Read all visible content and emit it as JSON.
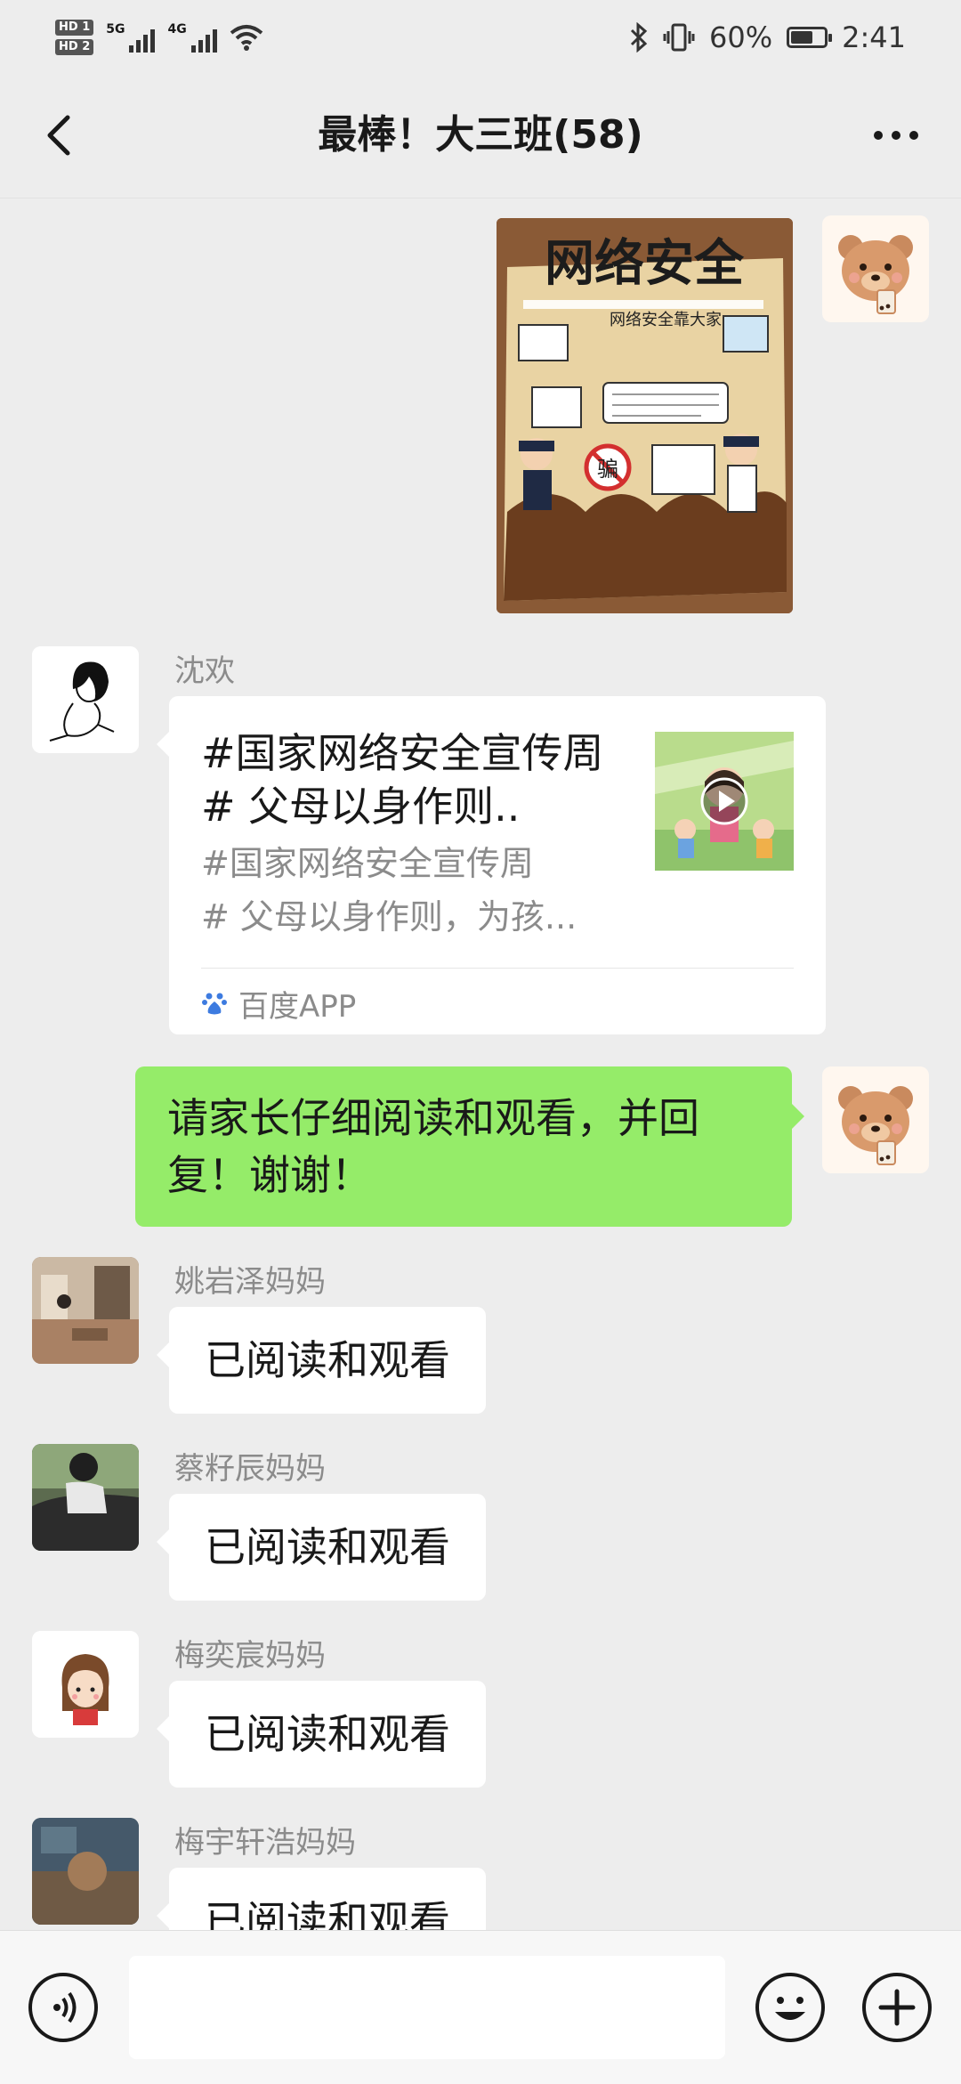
{
  "status_bar": {
    "hd1": "HD 1",
    "hd2": "HD 2",
    "net1": "5G",
    "net2": "4G",
    "battery_percent": "60%",
    "battery_level": 0.6,
    "time": "2:41"
  },
  "header": {
    "title": "最棒！大三班(58)"
  },
  "messages": {
    "link_card": {
      "sender": "沈欢",
      "title": "#国家网络安全宣传周# 父母以身作则..",
      "desc_line1": "#国家网络安全宣传周",
      "desc_line2": "# 父母以身作则，为孩...",
      "source": "百度APP"
    },
    "my_text": "请家长仔细阅读和观看，并回复！谢谢！",
    "replies": [
      {
        "sender": "姚岩泽妈妈",
        "text": "已阅读和观看"
      },
      {
        "sender": "蔡籽辰妈妈",
        "text": "已阅读和观看"
      },
      {
        "sender": "梅奕宸妈妈",
        "text": "已阅读和观看"
      },
      {
        "sender": "梅宇轩浩妈妈",
        "text": "已阅读和观看"
      }
    ]
  },
  "poster": {
    "title": "网络安全",
    "subtitle": "网络安全靠大家",
    "sign": "骗"
  },
  "colors": {
    "background": "#ededed",
    "my_bubble": "#95ec69",
    "their_bubble": "#ffffff"
  },
  "icons": [
    "back-arrow-icon",
    "more-icon",
    "bluetooth-icon",
    "vibrate-icon",
    "wifi-icon",
    "battery-icon",
    "voice-icon",
    "emoji-icon",
    "plus-icon",
    "baidu-icon",
    "play-icon"
  ]
}
